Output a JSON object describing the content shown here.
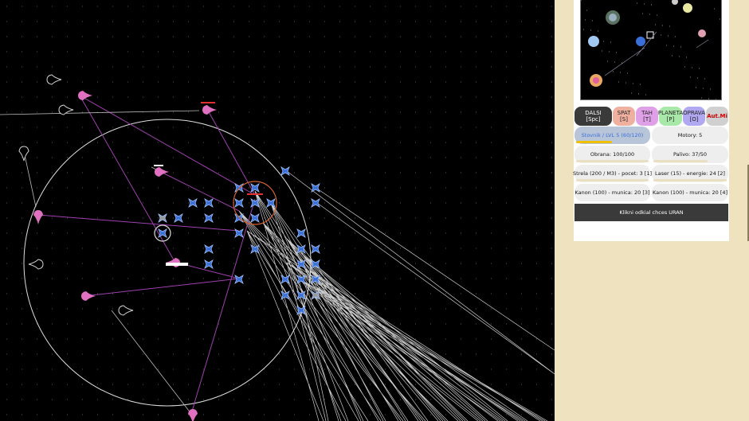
{
  "colors": {
    "space": "#000000",
    "ship_player": "#3a6fd8",
    "ship_enemy": "#c8409a",
    "beam": "#ffffff",
    "beam_enemy": "#b040b0",
    "panel_bg": "#efe3bf"
  },
  "buttons": [
    {
      "label": "DALSI\n[Spc]",
      "bg": "#3a3a3a",
      "fg": "#ffffff",
      "name": "next-turn-button"
    },
    {
      "label": "SPAT\n[S]",
      "bg": "#f0b0a0",
      "fg": "#222222",
      "name": "back-button"
    },
    {
      "label": "TAH\n[T]",
      "bg": "#e0a0e8",
      "fg": "#222222",
      "name": "move-button"
    },
    {
      "label": "PLANETA\n[P]",
      "bg": "#a8e8a8",
      "fg": "#222222",
      "name": "planet-button"
    },
    {
      "label": "OPRAVA\n[O]",
      "bg": "#b0a8f0",
      "fg": "#222222",
      "name": "repair-button"
    },
    {
      "label": "Aut.Mi",
      "bg": "#d0d0d0",
      "fg": "#cc0000",
      "name": "auto-mission-button"
    }
  ],
  "stats": {
    "name_level": "Stovnik / LVL 5 (60/120)",
    "name_level_progress": 0.5,
    "engines": "Motory: 5",
    "armor": "Obrana: 100/100",
    "armor_progress": 1.0,
    "fuel": "Palivo: 37/50",
    "fuel_progress": 0.74,
    "weapon1": "Strela (200 / M3) - pocet: 3  [1]",
    "weapon2": "Laser (15) - energie: 24  [2]",
    "weapon3": "Kanon (100) - munica: 20  [3]",
    "weapon4": "Kanon (100) - munica: 20  [4]"
  },
  "status": "Klikni odkial chces URAN",
  "icons": {
    "player_ship": "player-ship-icon",
    "enemy_ship": "enemy-ship-icon",
    "planet": "planet-icon"
  }
}
